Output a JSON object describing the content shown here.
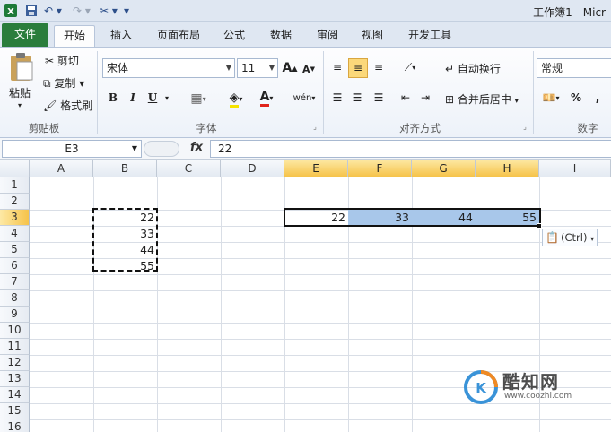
{
  "window": {
    "title": "工作簿1 - Micr"
  },
  "tabs": [
    "文件",
    "开始",
    "插入",
    "页面布局",
    "公式",
    "数据",
    "审阅",
    "视图",
    "开发工具"
  ],
  "clipboard": {
    "paste": "粘贴",
    "cut": "剪切",
    "copy": "复制",
    "format_painter": "格式刷",
    "label": "剪贴板"
  },
  "font": {
    "name": "宋体",
    "size": "11",
    "bold": "B",
    "italic": "I",
    "underline": "U",
    "label": "字体",
    "increase": "A",
    "decrease": "A",
    "phonetic": "wén"
  },
  "alignment": {
    "wrap": "自动换行",
    "merge": "合并后居中",
    "label": "对齐方式"
  },
  "number": {
    "format": "常规",
    "percent": "%",
    "label": "数字"
  },
  "formula_bar": {
    "name_box": "E3",
    "fx": "fx",
    "value": "22"
  },
  "columns": [
    "A",
    "B",
    "C",
    "D",
    "E",
    "F",
    "G",
    "H",
    "I"
  ],
  "rows": [
    "1",
    "2",
    "3",
    "4",
    "5",
    "6",
    "7",
    "8",
    "9",
    "10",
    "11",
    "12",
    "13",
    "14",
    "15",
    "16"
  ],
  "cells": {
    "B3": "22",
    "B4": "33",
    "B5": "44",
    "B6": "55",
    "E3": "22",
    "F3": "33",
    "G3": "44",
    "H3": "55"
  },
  "paste_options": "(Ctrl)",
  "watermark": {
    "brand": "酷知网",
    "url": "www.coozhi.com"
  },
  "colors": {
    "file_tab": "#2a7d3c",
    "selection_fill": "#a8c7ea",
    "header_selected": "#f6c34a"
  }
}
